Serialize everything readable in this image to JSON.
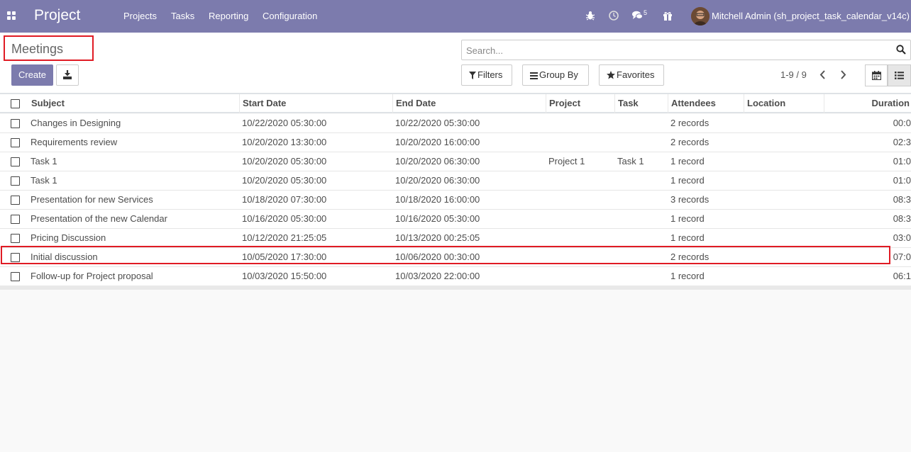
{
  "navbar": {
    "brand": "Project",
    "menu": [
      "Projects",
      "Tasks",
      "Reporting",
      "Configuration"
    ],
    "chat_count": "5",
    "user_name": "Mitchell Admin (sh_project_task_calendar_v14c)"
  },
  "control": {
    "title": "Meetings",
    "create_label": "Create",
    "search_placeholder": "Search...",
    "filters_label": "Filters",
    "groupby_label": "Group By",
    "favorites_label": "Favorites",
    "pager": "1-9 / 9"
  },
  "table": {
    "headers": [
      "Subject",
      "Start Date",
      "End Date",
      "Project",
      "Task",
      "Attendees",
      "Location",
      "Duration"
    ],
    "rows": [
      {
        "subject": "Changes in Designing",
        "start": "10/22/2020 05:30:00",
        "end": "10/22/2020 05:30:00",
        "project": "",
        "task": "",
        "attendees": "2 records",
        "location": "",
        "duration": "00:0"
      },
      {
        "subject": "Requirements review",
        "start": "10/20/2020 13:30:00",
        "end": "10/20/2020 16:00:00",
        "project": "",
        "task": "",
        "attendees": "2 records",
        "location": "",
        "duration": "02:3"
      },
      {
        "subject": "Task 1",
        "start": "10/20/2020 05:30:00",
        "end": "10/20/2020 06:30:00",
        "project": "Project 1",
        "task": "Task 1",
        "attendees": "1 record",
        "location": "",
        "duration": "01:0"
      },
      {
        "subject": "Task 1",
        "start": "10/20/2020 05:30:00",
        "end": "10/20/2020 06:30:00",
        "project": "",
        "task": "",
        "attendees": "1 record",
        "location": "",
        "duration": "01:0"
      },
      {
        "subject": "Presentation for new Services",
        "start": "10/18/2020 07:30:00",
        "end": "10/18/2020 16:00:00",
        "project": "",
        "task": "",
        "attendees": "3 records",
        "location": "",
        "duration": "08:3"
      },
      {
        "subject": "Presentation of the new Calendar",
        "start": "10/16/2020 05:30:00",
        "end": "10/16/2020 05:30:00",
        "project": "",
        "task": "",
        "attendees": "1 record",
        "location": "",
        "duration": "08:3"
      },
      {
        "subject": "Pricing Discussion",
        "start": "10/12/2020 21:25:05",
        "end": "10/13/2020 00:25:05",
        "project": "",
        "task": "",
        "attendees": "1 record",
        "location": "",
        "duration": "03:0"
      },
      {
        "subject": "Initial discussion",
        "start": "10/05/2020 17:30:00",
        "end": "10/06/2020 00:30:00",
        "project": "",
        "task": "",
        "attendees": "2 records",
        "location": "",
        "duration": "07:0"
      },
      {
        "subject": "Follow-up for Project proposal",
        "start": "10/03/2020 15:50:00",
        "end": "10/03/2020 22:00:00",
        "project": "",
        "task": "",
        "attendees": "1 record",
        "location": "",
        "duration": "06:1"
      }
    ]
  },
  "colors": {
    "accent": "#7c7bad",
    "highlight": "#e01b24"
  }
}
